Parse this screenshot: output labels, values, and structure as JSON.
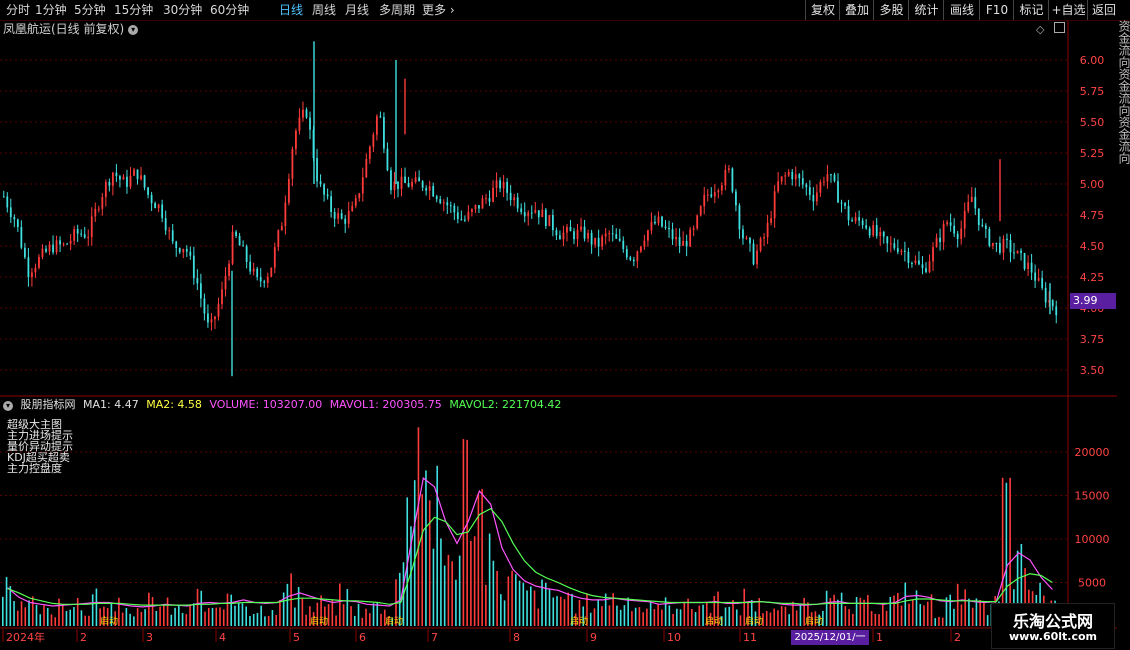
{
  "toolbar": {
    "periods": [
      "分时",
      "1分钟",
      "5分钟",
      "15分钟",
      "30分钟",
      "60分钟",
      "日线",
      "周线",
      "月线",
      "多周期"
    ],
    "active_period": "日线",
    "more_label": "更多",
    "right_buttons": [
      "复权",
      "叠加",
      "多股",
      "统计",
      "画线",
      "F10",
      "标记",
      "+自选",
      "返回"
    ]
  },
  "price_panel": {
    "title": "凤凰航运(日线 前复权)",
    "current_price_tag": "3.99"
  },
  "indicator_panel": {
    "name": "股朋指标网",
    "ma1": "MA1: 4.47",
    "ma2": "MA2: 4.58",
    "volume": "VOLUME: 103207.00",
    "mavol1": "MAVOL1: 200305.75",
    "mavol2": "MAVOL2: 221704.42",
    "legend": [
      "超级大主图",
      "主力进场提示",
      "量价异动提示",
      "KDJ超买超卖",
      "主力控盘度"
    ],
    "signal_labels": [
      "启动",
      "启动",
      "启动",
      "启动",
      "启动",
      "启动",
      "启动"
    ]
  },
  "x_axis": {
    "labels": [
      "2024年",
      "2",
      "3",
      "4",
      "5",
      "6",
      "7",
      "8",
      "9",
      "10",
      "11",
      "12",
      "1",
      "2"
    ],
    "cursor_date": "2025/12/01/一"
  },
  "watermark": {
    "title": "乐淘公式网",
    "url": "www.60lt.com"
  },
  "right_strip_text": "资金流向资金流向资金流向",
  "colors": {
    "up": "#ff3b3b",
    "down": "#3fe0e0",
    "grid": "#5a0000",
    "ma1": "#ff55ff",
    "ma2": "#55ff55",
    "tag_bg": "#5a1fa0"
  },
  "chart_data": [
    {
      "type": "candlestick",
      "title": "凤凰航运(日线 前复权)",
      "y_ticks": [
        3.5,
        3.75,
        4.0,
        4.25,
        4.5,
        4.75,
        5.0,
        5.25,
        5.5,
        5.75,
        6.0
      ],
      "ylim": [
        3.4,
        6.2
      ],
      "grid": true,
      "close_path": [
        4.9,
        4.7,
        4.3,
        4.4,
        4.5,
        4.5,
        4.6,
        4.6,
        4.9,
        5.1,
        5.0,
        5.1,
        4.9,
        4.8,
        4.5,
        4.5,
        4.2,
        3.8,
        4.1,
        4.6,
        4.4,
        4.2,
        4.3,
        4.7,
        5.4,
        5.6,
        5.0,
        4.8,
        4.7,
        4.8,
        5.2,
        5.6,
        5.0,
        5.0,
        5.0,
        5.0,
        4.9,
        4.8,
        4.7,
        4.8,
        4.9,
        5.0,
        4.9,
        4.8,
        4.8,
        4.7,
        4.6,
        4.6,
        4.6,
        4.5,
        4.6,
        4.5,
        4.4,
        4.6,
        4.7,
        4.6,
        4.5,
        4.6,
        4.9,
        5.0,
        5.1,
        4.6,
        4.4,
        4.6,
        5.0,
        5.1,
        5.0,
        4.9,
        5.1,
        4.9,
        4.7,
        4.7,
        4.6,
        4.5,
        4.5,
        4.4,
        4.3,
        4.5,
        4.7,
        4.6,
        4.9,
        4.6,
        4.5,
        4.5,
        4.4,
        4.3,
        4.1,
        4.0
      ]
    },
    {
      "type": "bar",
      "title": "股朋指标网",
      "y_ticks": [
        5000,
        10000,
        15000,
        20000
      ],
      "ylim": [
        0,
        24000
      ],
      "series": [
        {
          "name": "VOLUME",
          "values": [
            4200,
            2100,
            2600,
            1900,
            1700,
            3300,
            2400,
            1800,
            3600,
            2000,
            2400,
            2100,
            1500,
            3100,
            2500,
            2000,
            1900,
            3600,
            2200,
            1800,
            2700,
            3400,
            2000,
            2200,
            2500,
            4800,
            3200,
            2100,
            2800,
            2300,
            3700,
            2200,
            1700,
            2500,
            1800,
            6500,
            21000,
            23500,
            14000,
            8500,
            9000,
            18500,
            15000,
            7800,
            5200,
            5600,
            4300,
            3800,
            4200,
            3900,
            2800,
            2600,
            2900,
            3300,
            3600,
            2400,
            2500,
            2300,
            1800,
            2600,
            3100,
            2400,
            2700,
            2900,
            2000,
            2300,
            3500,
            2600,
            2300,
            1900,
            2100,
            2400,
            2600,
            3000,
            2900,
            2100,
            2500,
            2600,
            2300,
            3000,
            4500,
            3300,
            2900,
            1800,
            2800,
            3600,
            2400,
            2200,
            2800,
            15000,
            7500,
            5200,
            4000,
            3000
          ]
        },
        {
          "name": "MAVOL1",
          "values": [
            4400,
            3300,
            2700,
            2500,
            2300,
            2400,
            2500,
            2600,
            2700,
            2700,
            2500,
            2300,
            2200,
            2300,
            2500,
            2400,
            2300,
            2600,
            2700,
            2600,
            2700,
            3000,
            2700,
            2600,
            2700,
            3400,
            3800,
            3400,
            3000,
            2700,
            2900,
            2800,
            2500,
            2400,
            2300,
            3000,
            10000,
            17000,
            16000,
            12000,
            9500,
            12000,
            15500,
            14000,
            9000,
            6500,
            5200,
            4600,
            4300,
            4100,
            3600,
            3200,
            3000,
            3000,
            3200,
            3000,
            2900,
            2800,
            2500,
            2600,
            2700,
            2700,
            2700,
            2800,
            2600,
            2600,
            2800,
            2800,
            2700,
            2500,
            2400,
            2400,
            2500,
            2700,
            2800,
            2600,
            2600,
            2600,
            2500,
            2700,
            3400,
            3500,
            3300,
            2900,
            2800,
            3000,
            2800,
            2700,
            2800,
            7000,
            8400,
            7600,
            5600,
            4200
          ]
        },
        {
          "name": "MAVOL2",
          "values": [
            4300,
            3800,
            3200,
            2900,
            2600,
            2500,
            2500,
            2500,
            2600,
            2600,
            2600,
            2500,
            2400,
            2400,
            2400,
            2400,
            2400,
            2500,
            2500,
            2600,
            2600,
            2700,
            2700,
            2700,
            2700,
            3000,
            3200,
            3200,
            3100,
            3000,
            2900,
            2900,
            2800,
            2700,
            2500,
            2700,
            6500,
            11000,
            12500,
            12000,
            10500,
            10800,
            12800,
            13500,
            12000,
            9500,
            7500,
            6200,
            5500,
            5000,
            4400,
            3900,
            3500,
            3300,
            3200,
            3100,
            3000,
            2900,
            2800,
            2700,
            2700,
            2700,
            2700,
            2700,
            2700,
            2700,
            2700,
            2800,
            2700,
            2600,
            2600,
            2500,
            2500,
            2600,
            2600,
            2600,
            2600,
            2600,
            2600,
            2600,
            2900,
            3100,
            3100,
            3000,
            2900,
            2900,
            2900,
            2800,
            2800,
            4600,
            5500,
            6000,
            5800,
            5000
          ]
        }
      ]
    }
  ]
}
